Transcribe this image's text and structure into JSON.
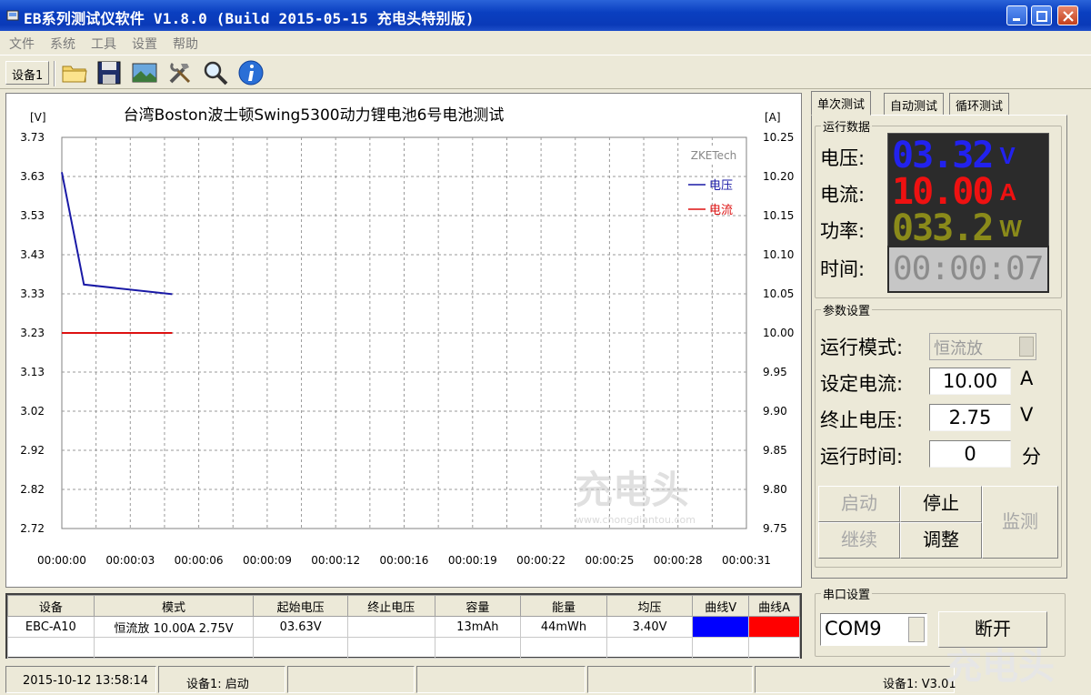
{
  "window": {
    "title": "EB系列测试仪软件 V1.8.0 (Build 2015-05-15 充电头特别版)"
  },
  "menu": [
    "文件",
    "系统",
    "工具",
    "设置",
    "帮助"
  ],
  "toolbar": {
    "device_tab": "设备1",
    "icons": [
      "folder-icon",
      "save-icon",
      "image-icon",
      "tools-icon",
      "search-icon",
      "info-icon"
    ]
  },
  "chart_data": {
    "type": "line",
    "title": "台湾Boston波士顿Swing5300动力锂电池6号电池测试",
    "ylabel_left": "[V]",
    "ylabel_right": "[A]",
    "brand": "ZKETech",
    "ylim_left": [
      2.72,
      3.73
    ],
    "ylim_right": [
      9.75,
      10.25
    ],
    "yticks_left": [
      "3.73",
      "3.63",
      "3.53",
      "3.43",
      "3.33",
      "3.23",
      "3.13",
      "3.02",
      "2.92",
      "2.82",
      "2.72"
    ],
    "yticks_right": [
      "10.25",
      "10.20",
      "10.15",
      "10.10",
      "10.05",
      "10.00",
      "9.95",
      "9.90",
      "9.85",
      "9.80",
      "9.75"
    ],
    "xticks": [
      "00:00:00",
      "00:00:03",
      "00:00:06",
      "00:00:09",
      "00:00:12",
      "00:00:16",
      "00:00:19",
      "00:00:22",
      "00:00:25",
      "00:00:28",
      "00:00:31"
    ],
    "xlim": [
      0,
      31
    ],
    "series": [
      {
        "name": "电压",
        "color": "#1a1aa6",
        "axis": "left",
        "x": [
          0,
          1,
          5
        ],
        "y": [
          3.64,
          3.35,
          3.325
        ]
      },
      {
        "name": "电流",
        "color": "#dd1111",
        "axis": "right",
        "x": [
          0,
          5
        ],
        "y": [
          10.0,
          10.0
        ]
      }
    ],
    "legend": "top-right",
    "grid": true
  },
  "table": {
    "headers": [
      "设备",
      "模式",
      "起始电压",
      "终止电压",
      "容量",
      "能量",
      "均压",
      "曲线V",
      "曲线A"
    ],
    "rows": [
      [
        "EBC-A10",
        "恒流放 10.00A 2.75V",
        "03.63V",
        "",
        "13mAh",
        "44mWh",
        "3.40V",
        "",
        ""
      ]
    ],
    "curve_colors": {
      "v": "#0000ff",
      "a": "#ff0000"
    }
  },
  "status": {
    "time": "2015-10-12 13:58:14",
    "device_state": "设备1: 启动",
    "version": "设备1: V3.01"
  },
  "right_tabs": [
    "单次测试",
    "自动测试",
    "循环测试"
  ],
  "run_data": {
    "title": "运行数据",
    "voltage_label": "电压:",
    "voltage": "03.32",
    "voltage_unit": "V",
    "current_label": "电流:",
    "current": "10.00",
    "current_unit": "A",
    "power_label": "功率:",
    "power": "033.2",
    "power_unit": "W",
    "time_label": "时间:",
    "time": "00:00:07",
    "colors": {
      "voltage": "#2222ee",
      "current": "#ee1111",
      "power": "#8a8a1a"
    }
  },
  "params": {
    "title": "参数设置",
    "mode_label": "运行模式:",
    "mode_value": "恒流放",
    "set_current_label": "设定电流:",
    "set_current": "10.00",
    "set_current_unit": "A",
    "end_voltage_label": "终止电压:",
    "end_voltage": "2.75",
    "end_voltage_unit": "V",
    "run_time_label": "运行时间:",
    "run_time": "0",
    "run_time_unit": "分",
    "buttons": {
      "start": "启动",
      "stop": "停止",
      "monitor": "监测",
      "continue": "继续",
      "adjust": "调整"
    }
  },
  "serial": {
    "title": "串口设置",
    "port": "COM9",
    "disconnect": "断开"
  }
}
